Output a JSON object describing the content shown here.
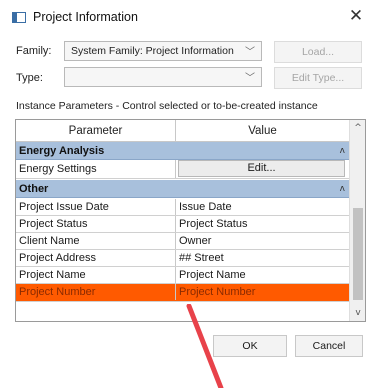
{
  "window": {
    "title": "Project Information",
    "close_glyph": "✕",
    "app_icon": "window-icon"
  },
  "family": {
    "label": "Family:",
    "value": "System Family: Project Information",
    "load_button": "Load..."
  },
  "type": {
    "label": "Type:",
    "value": "",
    "edit_type_button": "Edit Type..."
  },
  "instance_caption": "Instance Parameters - Control selected or to-be-created instance",
  "grid": {
    "columns": [
      "Parameter",
      "Value"
    ],
    "groups": [
      {
        "name": "Energy Analysis",
        "collapse_glyph": "ʌ",
        "rows": [
          {
            "parameter": "Energy Settings",
            "value": "Edit..."
          }
        ]
      },
      {
        "name": "Other",
        "collapse_glyph": "ʌ",
        "rows": [
          {
            "parameter": "Project Issue Date",
            "value": "Issue Date"
          },
          {
            "parameter": "Project Status",
            "value": "Project  Status"
          },
          {
            "parameter": "Client Name",
            "value": "Owner"
          },
          {
            "parameter": "Project Address",
            "value": "## Street"
          },
          {
            "parameter": "Project Name",
            "value": "Project Name"
          },
          {
            "parameter": "Project Number",
            "value": "Project  Number"
          }
        ]
      }
    ],
    "scroll_up": "^",
    "scroll_down": "v"
  },
  "buttons": {
    "ok": "OK",
    "cancel": "Cancel"
  },
  "colors": {
    "group_header": "#a8c0dc",
    "highlight": "#ff5a00",
    "annotation_arrow": "#e8424a"
  }
}
